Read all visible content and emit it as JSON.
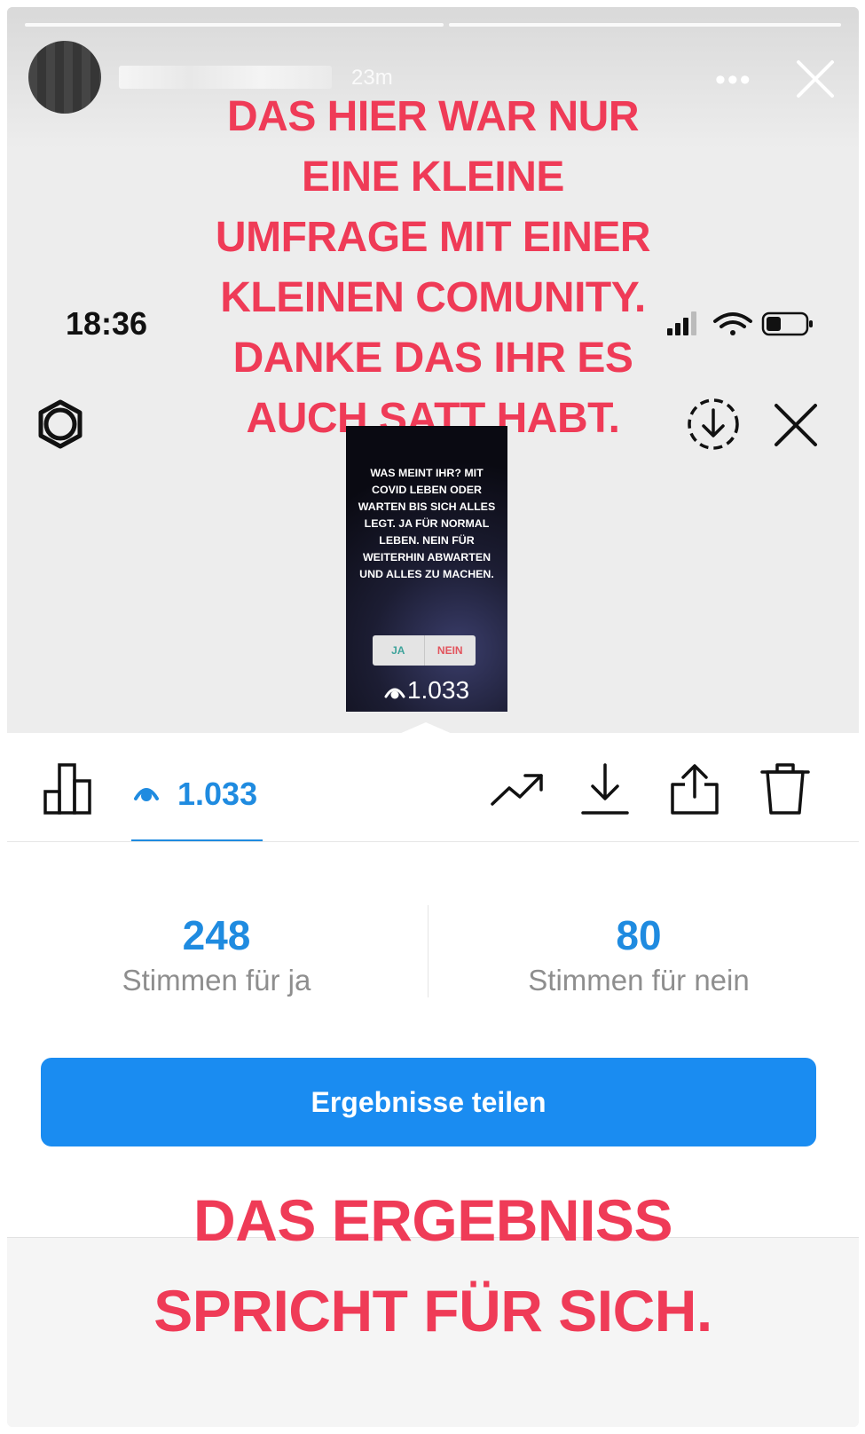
{
  "story": {
    "timestamp": "23m",
    "more_label": "•••",
    "headline_lines": [
      "DAS HIER WAR NUR",
      "EINE KLEINE",
      "UMFRAGE MIT EINER",
      "KLEINEN COMUNITY.",
      "DANKE DAS IHR ES",
      "AUCH SATT HABT."
    ],
    "footer_lines": [
      "DAS ERGEBNISS",
      "SPRICHT FÜR SICH."
    ],
    "overlay_color": "#ef3b57"
  },
  "status_bar": {
    "time": "18:36"
  },
  "thumbnail": {
    "question": "WAS MEINT IHR? MIT COVID LEBEN ODER WARTEN BIS SICH ALLES LEGT. JA FÜR NORMAL LEBEN. NEIN FÜR WEITERHIN ABWARTEN UND ALLES ZU MACHEN.",
    "poll_yes": "JA",
    "poll_no": "NEIN",
    "views": "1.033"
  },
  "sheet": {
    "viewers_count": "1.033",
    "accent": "#1f8be0"
  },
  "results": {
    "yes_count": "248",
    "yes_label": "Stimmen für ja",
    "no_count": "80",
    "no_label": "Stimmen für nein",
    "yes_fraction": 0.756,
    "no_fraction": 0.244
  },
  "share_button": {
    "label": "Ergebnisse teilen",
    "color": "#1a8cf1"
  }
}
